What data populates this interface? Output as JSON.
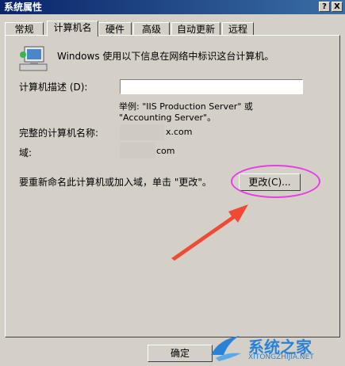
{
  "window": {
    "title": "系统属性",
    "help": "?",
    "close": "X"
  },
  "tabs": [
    "常规",
    "计算机名",
    "硬件",
    "高级",
    "自动更新",
    "远程"
  ],
  "intro": "Windows 使用以下信息在网络中标识这台计算机。",
  "description": {
    "label": "计算机描述 (D):",
    "value": ""
  },
  "example_line1": "举例: \"IIS Production Server\" 或",
  "example_line2": "\"Accounting Server\"。",
  "full_name": {
    "label": "完整的计算机名称:",
    "value_suffix": "x.com"
  },
  "domain": {
    "label": "域:",
    "value_suffix": "com"
  },
  "rename_text": "要重新命名此计算机或加入域，单击 \"更改\"。",
  "change_button": "更改(C)...",
  "ok_button": "确定",
  "watermark": {
    "brand": "系统之家",
    "url": "XITONGZHIJIA.NET"
  },
  "colors": {
    "titlebar": "#0a246a",
    "annotation_circle": "#e83ce8",
    "arrow": "#f04a35"
  }
}
